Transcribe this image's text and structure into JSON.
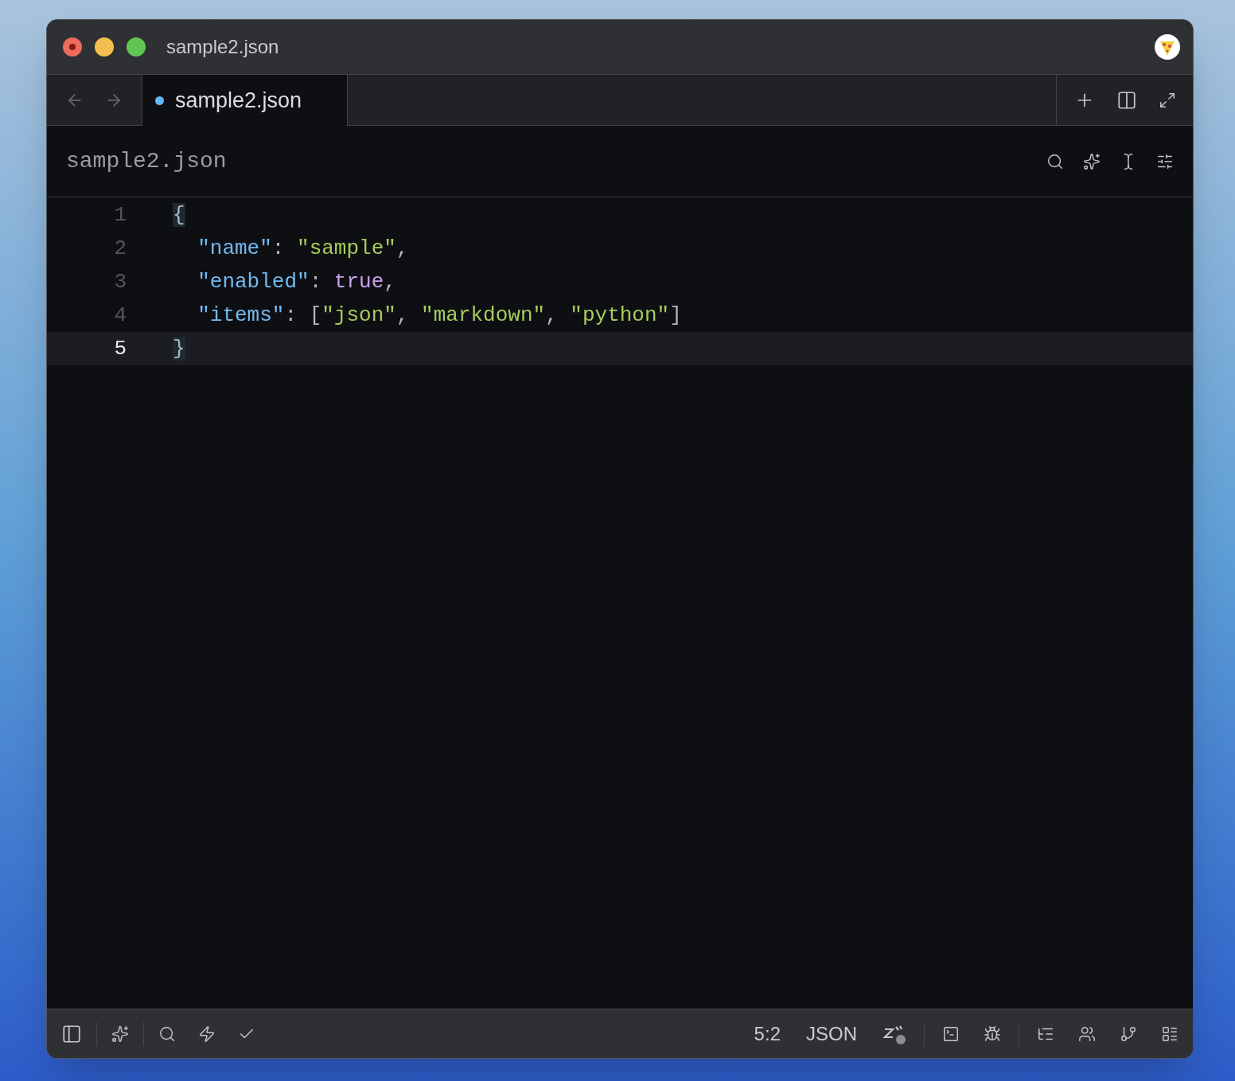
{
  "window": {
    "title": "sample2.json"
  },
  "navigation": [
    {
      "kind": "back",
      "disabled": true
    },
    {
      "kind": "forward",
      "disabled": true
    }
  ],
  "tabs": [
    {
      "label": "sample2.json",
      "selected": true,
      "modified": true
    }
  ],
  "breadcrumb": "sample2.json",
  "editor": {
    "lines": [
      {
        "number": "1",
        "current": false,
        "tokens": [
          {
            "kind": "bracket",
            "text": "{",
            "matched": true
          }
        ]
      },
      {
        "number": "2",
        "current": false,
        "tokens": [
          {
            "kind": "key",
            "text": "  \"name\""
          },
          {
            "kind": "punct",
            "text": ": "
          },
          {
            "kind": "string",
            "text": "\"sample\""
          },
          {
            "kind": "punct",
            "text": ","
          }
        ]
      },
      {
        "number": "3",
        "current": false,
        "tokens": [
          {
            "kind": "key",
            "text": "  \"enabled\""
          },
          {
            "kind": "punct",
            "text": ": "
          },
          {
            "kind": "bool",
            "text": "true"
          },
          {
            "kind": "punct",
            "text": ","
          }
        ]
      },
      {
        "number": "4",
        "current": false,
        "tokens": [
          {
            "kind": "key",
            "text": "  \"items\""
          },
          {
            "kind": "punct",
            "text": ": ["
          },
          {
            "kind": "string",
            "text": "\"json\""
          },
          {
            "kind": "punct",
            "text": ", "
          },
          {
            "kind": "string",
            "text": "\"markdown\""
          },
          {
            "kind": "punct",
            "text": ", "
          },
          {
            "kind": "string",
            "text": "\"python\""
          },
          {
            "kind": "punct",
            "text": "]"
          }
        ]
      },
      {
        "number": "5",
        "current": true,
        "tokens": [
          {
            "kind": "bracket",
            "text": "}",
            "matched": true
          }
        ]
      }
    ]
  },
  "status_bar": {
    "cursor_position": "5:2",
    "language": "JSON"
  }
}
